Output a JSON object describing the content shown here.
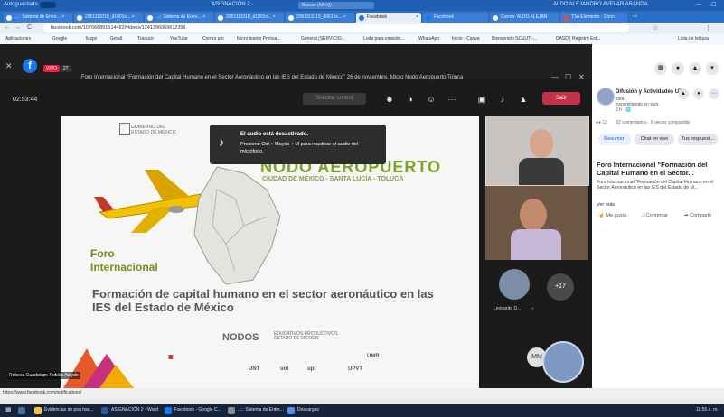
{
  "window": {
    "left_label": "Autoguardado",
    "title": "ASIGNACIÓN 2 -",
    "search_placeholder": "Buscar (Alt+Q)",
    "user": "ALDO ALEJANDRO AVELAR ARANDA"
  },
  "tabs": [
    {
      "label": "...:: Sistema de Entre... ×"
    },
    {
      "label": "2051111010_d1001n... ×"
    },
    {
      "label": "...:: Sistema de Entre... ×"
    },
    {
      "label": "2051111010_d1001n... ×"
    },
    {
      "label": "2051111010_d0615n... ×"
    },
    {
      "label": "Facebook"
    },
    {
      "label": "Facebook"
    },
    {
      "label": "Correo: ALDO ALEJAN"
    },
    {
      "label": "T3A Elemento · Conn"
    }
  ],
  "address": {
    "url": "facebook.com/107668891514482/videos/1241396069672396"
  },
  "bookmarks": [
    "Aplicaciones",
    "Google",
    "Maps",
    "Gmail",
    "Traducir",
    "YouTube",
    "Correo utn",
    "Micro teams Prensa...",
    "General (SERVICIO...",
    "Loda para emisión...",
    "WhatsApp",
    "Inicio - Canva",
    "Bienvenido SCEUT -...",
    "DASD | Registro Est...",
    "Lista de lectura"
  ],
  "meeting": {
    "title": "Foro Internacional \"Formación del Capital Humano en el Sector Aeronáutico en las IES del Estado de México\" 26 de noviembre. Micro Nodo Aeropuerto Toluca",
    "timer": "02:53:44",
    "request_button": "Solicitar control",
    "leave_button": "Salir",
    "badge_count": "27",
    "live_label": "VIVO",
    "tooltip_title": "El audio está desactivado.",
    "tooltip_body": "Presione Ctrl + Mayús + M para reactivar el audio del micrófono.",
    "speaker_name": "Rebeca Guadalupe Robles Atayde",
    "participant_name": "Leonardo D...",
    "more_participants": "+17",
    "initials": "MM"
  },
  "slide": {
    "gob_line1": "GOBIERNO DEL",
    "gob_line2": "ESTADO DE MÉXICO",
    "nodo": "NODO AEROPUERTO",
    "nodo_sub": "CIUDAD DE MÉXICO - SANTA LUCÍA - TOLUCA",
    "foro_line1": "Foro",
    "foro_line2": "Internacional",
    "title": "Formación de capital humano en el sector aeronáutico en las IES del Estado de México",
    "nodos": "NODOS",
    "nodos_sub1": "EDUCATIVOS-PRODUCTIVOS",
    "nodos_sub2": "ESTADO DE MÉXICO",
    "logos": [
      "UMB",
      "UNT",
      "uot",
      "upt",
      "UPVT"
    ]
  },
  "facebook": {
    "page_name": "Difusión y Actividades UTN",
    "status_line1": "está",
    "status_line2": "transmitiendo en vivo.",
    "status_line3": "2 h · 🌐",
    "reactions": "12",
    "comments": "62 comentarios · 8 veces compartido",
    "pills": [
      "Resumen",
      "Chat en vivo",
      "Tus respuest..."
    ],
    "post_title": "Foro Internacional \"Formación del Capital Humano en el Sector...",
    "post_desc": "Foro Internacional \"Formación del Capital Humano en el Sector Aeronáutico en las IES del Estado de M...",
    "see_more": "Ver más",
    "actions": [
      "Me gusta",
      "Comentar",
      "Compartir"
    ]
  },
  "status_bar": {
    "url": "https://www.facebook.com/notifications/"
  },
  "taskbar": {
    "items": [
      "Evidencias de poa has...",
      "ASIGNACIÓN 2 - Word",
      "Facebook - Google C...",
      "...:: Sistema de Entre...",
      "Descargas"
    ],
    "clock": "11:55 a. m."
  },
  "colors": {
    "accent": "#1877f2",
    "leave": "#c4314b",
    "foro_green": "#7a8a1e"
  }
}
